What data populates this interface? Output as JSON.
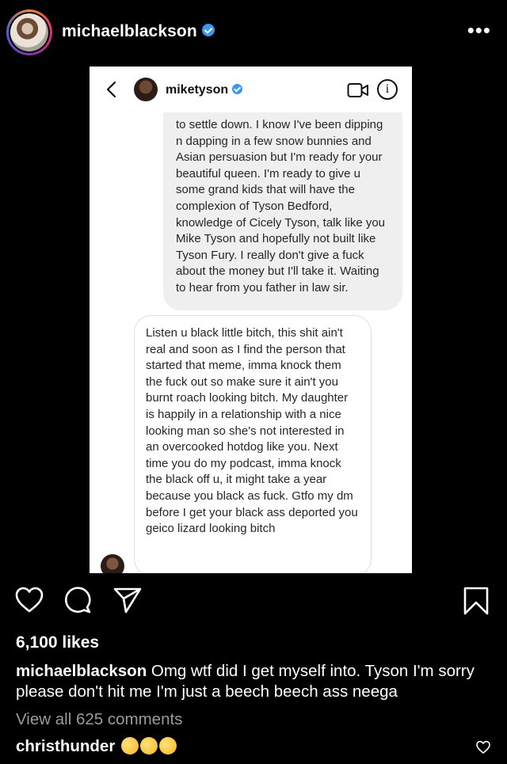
{
  "post": {
    "username": "michaelblackson",
    "more_label": "•••"
  },
  "dm": {
    "name": "miketyson",
    "bubble_them": "to settle down. I know I've been dipping n dapping in a few snow bunnies and Asian persuasion but I'm ready for your beautiful queen. I'm ready to give u some grand kids that will have the complexion of Tyson Bedford, knowledge of Cicely Tyson, talk like you Mike Tyson and hopefully not built like Tyson Fury. I really don't give a fuck about the money but I'll take it. Waiting to hear from you father in law sir.",
    "bubble_me": "Listen u black little bitch, this shit ain't real and soon as I find the person that started that meme, imma knock them the fuck out so make sure it ain't you burnt roach looking bitch. My daughter is happily in a relationship with a nice looking man so she's not interested in an overcooked hotdog like you. Next time you do my podcast, imma knock the black off u, it might take a year because you black as fuck. Gtfo my dm before I get your black ass deported you geico lizard looking bitch"
  },
  "likes": "6,100 likes",
  "caption": {
    "user": "michaelblackson",
    "text": " Omg wtf did I get myself into. Tyson I'm sorry please don't hit me I'm just a beech beech ass neega"
  },
  "view_comments": "View all 625 comments",
  "comment": {
    "user": "christhunder"
  },
  "colors": {
    "background": "#000000",
    "verified": "#3897f0",
    "muted": "#9a9a9a"
  },
  "icons": [
    "more-icon",
    "back-icon",
    "video-icon",
    "info-icon",
    "heart-icon",
    "comment-icon",
    "share-icon",
    "bookmark-icon",
    "laughing-emoji-icon"
  ]
}
